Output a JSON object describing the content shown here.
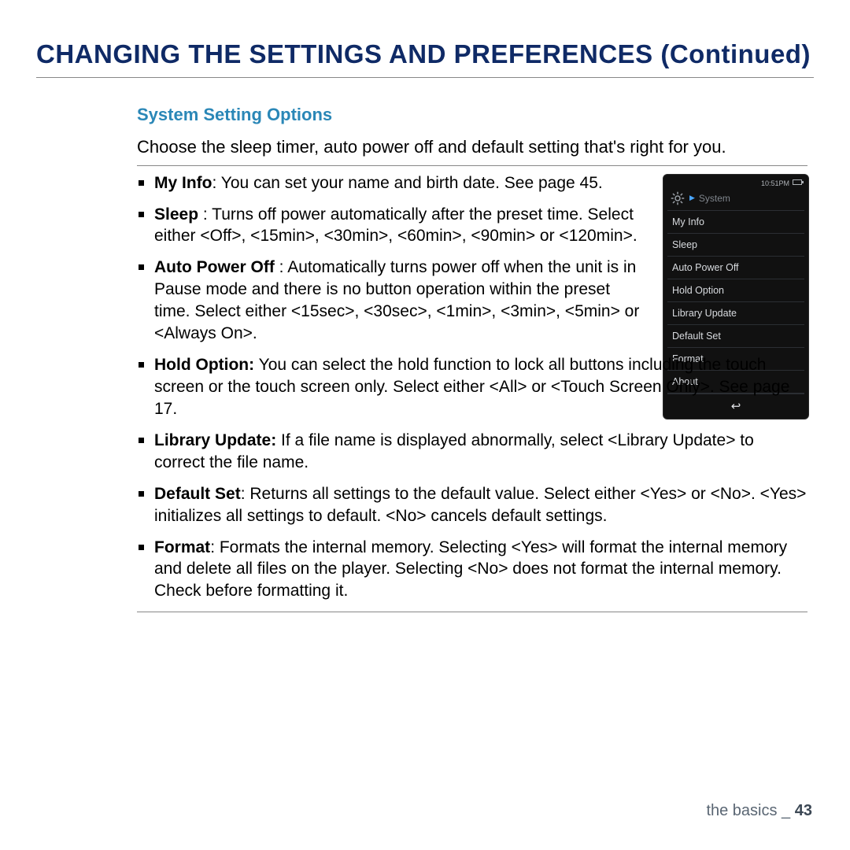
{
  "pageTitle": "CHANGING THE SETTINGS AND PREFERENCES (Continued)",
  "section": {
    "heading": "System Setting Options",
    "intro": "Choose the sleep timer, auto power off and default setting that's right for you."
  },
  "bullets": [
    {
      "label": "My Info",
      "sep": ": ",
      "text": "You can set your name and birth date. See page 45."
    },
    {
      "label": "Sleep",
      "sep": " : ",
      "text": "Turns off power automatically after the preset time. Select either <Off>, <15min>, <30min>, <60min>, <90min> or <120min>."
    },
    {
      "label": "Auto Power Off",
      "sep": " : ",
      "text": "Automatically turns power off when the unit is in Pause mode and there is no button operation within the preset time. Select either <15sec>, <30sec>, <1min>, <3min>, <5min> or <Always On>."
    },
    {
      "label": "Hold Option:",
      "sep": " ",
      "text": "You can select the hold function to lock all buttons including the touch screen or the touch screen only. Select either <All> or <Touch Screen Only>. See page 17."
    },
    {
      "label": "Library Update:",
      "sep": " ",
      "text": "If a file name is displayed abnormally, select <Library Update> to correct the file name."
    },
    {
      "label": "Default Set",
      "sep": ": ",
      "text": "Returns all settings to the default value. Select either <Yes> or <No>. <Yes> initializes all settings to default. <No> cancels default settings."
    },
    {
      "label": "Format",
      "sep": ": ",
      "text": "Formats the internal memory. Selecting <Yes> will format the internal memory and delete all files on the player. Selecting <No> does not format the internal memory. Check before formatting it."
    }
  ],
  "device": {
    "time": "10:51PM",
    "title": "System",
    "items": [
      "My Info",
      "Sleep",
      "Auto Power Off",
      "Hold Option",
      "Library Update",
      "Default Set",
      "Format",
      "About"
    ]
  },
  "footer": {
    "section": "the basics",
    "sep": " _ ",
    "page": "43"
  }
}
